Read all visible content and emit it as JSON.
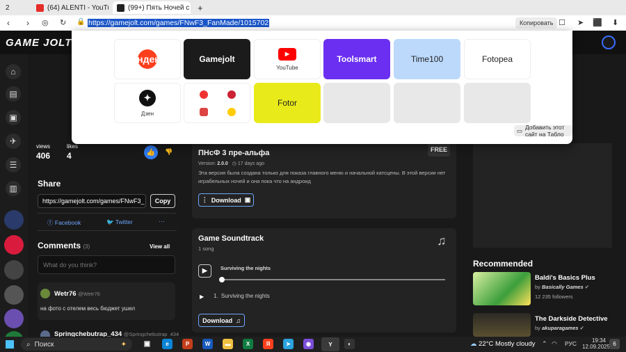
{
  "browser": {
    "tabs": [
      {
        "label": "2"
      },
      {
        "label": "(64) ALENTI - YouTube"
      },
      {
        "label": "(99+) Пять Ночей с Фр"
      }
    ],
    "new_tab": "+",
    "url": "https://gamejolt.com/games/FNwF3_FanMade/1015702",
    "copy_label": "Копировать"
  },
  "site": {
    "logo": "GAME JOLT"
  },
  "tableau": {
    "tiles": [
      {
        "label": "",
        "brand": "Яндекс"
      },
      {
        "label": "Gamejolt"
      },
      {
        "label": "YouTube"
      },
      {
        "label": "Toolsmart"
      },
      {
        "label": "Time100"
      },
      {
        "label": "Fotopea"
      },
      {
        "label": "Дзен"
      },
      {
        "label": "Fotor"
      }
    ],
    "add_site_label": "Добавить этот сайт на Табло"
  },
  "stats": {
    "views_label": "views",
    "views": "406",
    "likes_label": "likes",
    "likes": "4"
  },
  "share": {
    "title": "Share",
    "url_value": "https://gamejolt.com/games/FNwF3_",
    "copy": "Copy",
    "facebook": "Facebook",
    "twitter": "Twitter",
    "more": "···"
  },
  "comments": {
    "title": "Comments",
    "count": "(3)",
    "view_all": "View all",
    "placeholder": "What do you think?",
    "items": [
      {
        "user": "Wetr76",
        "handle": "@Wetr76",
        "text": "на фото с отелем весь бюджет ушел"
      },
      {
        "user": "Springchebutrap_434",
        "handle": "@Springchebutrap_434",
        "text": ""
      }
    ]
  },
  "release": {
    "title": "ПНсФ 3 пре-альфа",
    "price": "FREE",
    "version_label": "Version:",
    "version": "2.0.0",
    "age": "17 days ago",
    "desc1": "Эта версия была создана только для показа главного меню и начальной катсцены. В этой версии нет",
    "desc2": "играбельных ночей и она пока что на андроид",
    "download": "Download"
  },
  "soundtrack": {
    "title": "Game Soundtrack",
    "count": "1 song",
    "current": "Surviving the nights",
    "track_num": "1.",
    "track": "Surviving the nights",
    "download": "Download",
    "progress": 0
  },
  "recommended": {
    "title": "Recommended",
    "items": [
      {
        "title": "Baldi's Basics Plus",
        "by": "by",
        "author": "Basically Games",
        "meta": "12 235 followers"
      },
      {
        "title": "The Darkside Detective",
        "by": "by",
        "author": "akuparagames",
        "meta": ""
      }
    ]
  },
  "taskbar": {
    "search": "Поиск",
    "weather": "22°C  Mostly cloudy",
    "lang": "РУС",
    "time": "19:34",
    "date": "12.09.2025",
    "badge": "6"
  }
}
